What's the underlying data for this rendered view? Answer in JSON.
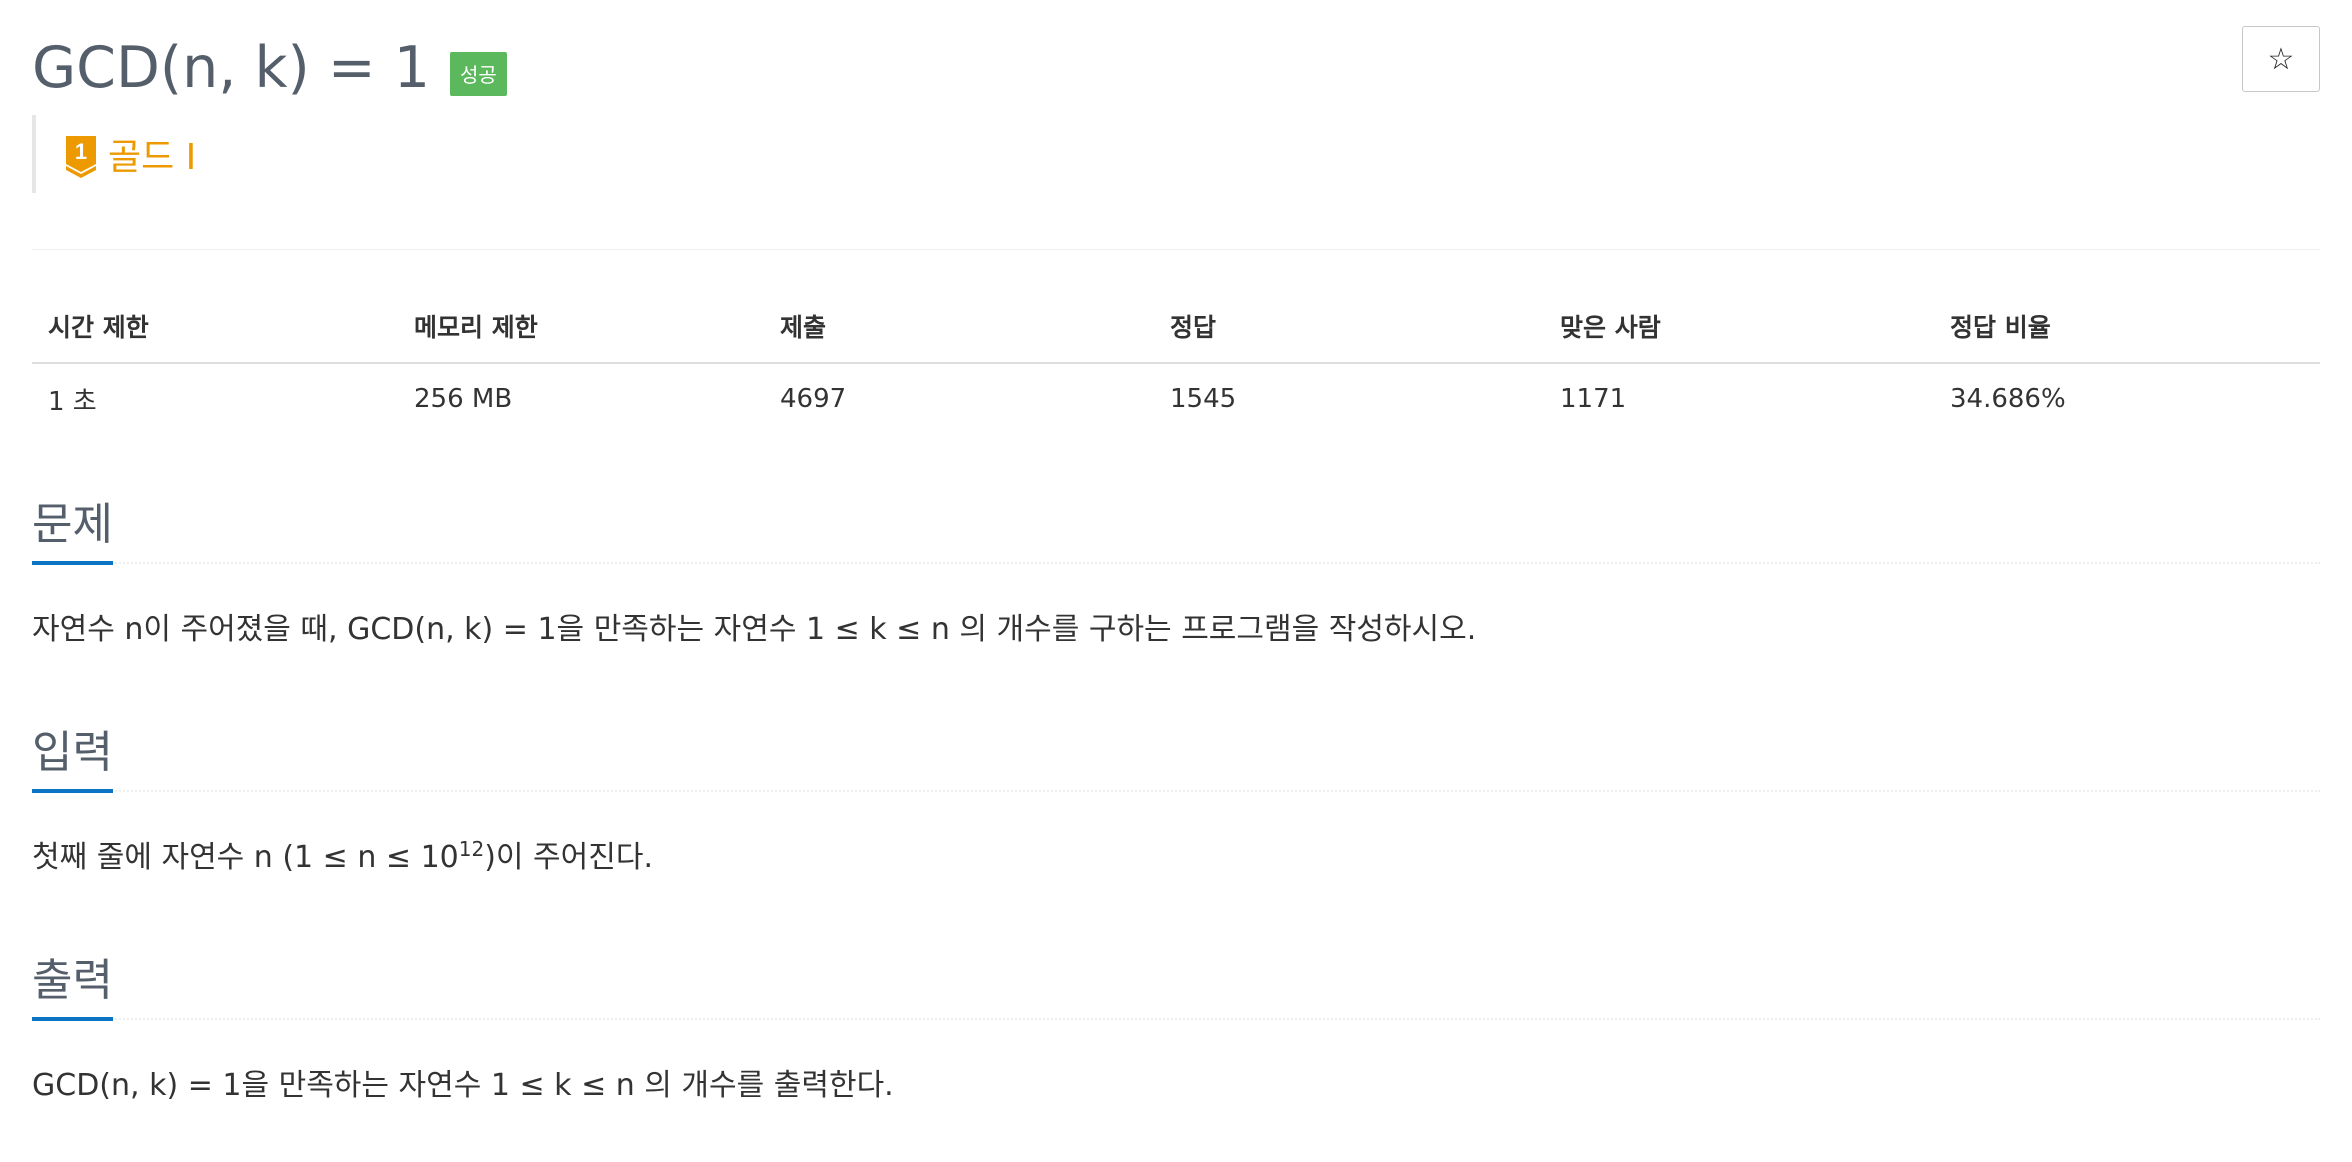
{
  "problem": {
    "title": "GCD(n, k) = 1",
    "status_badge": "성공",
    "star_icon": "star-icon",
    "tier": {
      "icon": "gold-tier-1-icon",
      "level_number": "1",
      "label": "골드 I",
      "color": "#ec9a00"
    }
  },
  "info_table": {
    "headers": [
      "시간 제한",
      "메모리 제한",
      "제출",
      "정답",
      "맞은 사람",
      "정답 비율"
    ],
    "values": [
      "1 초",
      "256 MB",
      "4697",
      "1545",
      "1171",
      "34.686%"
    ]
  },
  "sections": {
    "description": {
      "heading": "문제",
      "body": "자연수 n이 주어졌을 때, GCD(n, k) = 1을 만족하는 자연수 1 ≤ k ≤ n 의 개수를 구하는 프로그램을 작성하시오."
    },
    "input": {
      "heading": "입력",
      "body_before": "첫째 줄에 자연수 n (1 ≤ n ≤ 10",
      "body_sup": "12",
      "body_after": ")이 주어진다."
    },
    "output": {
      "heading": "출력",
      "body": "GCD(n, k) = 1을 만족하는 자연수 1 ≤ k ≤ n 의 개수를 출력한다."
    }
  },
  "colors": {
    "accent": "#0b74c4",
    "success": "#5cb85c",
    "gold": "#ec9a00",
    "heading": "#555f6b"
  }
}
